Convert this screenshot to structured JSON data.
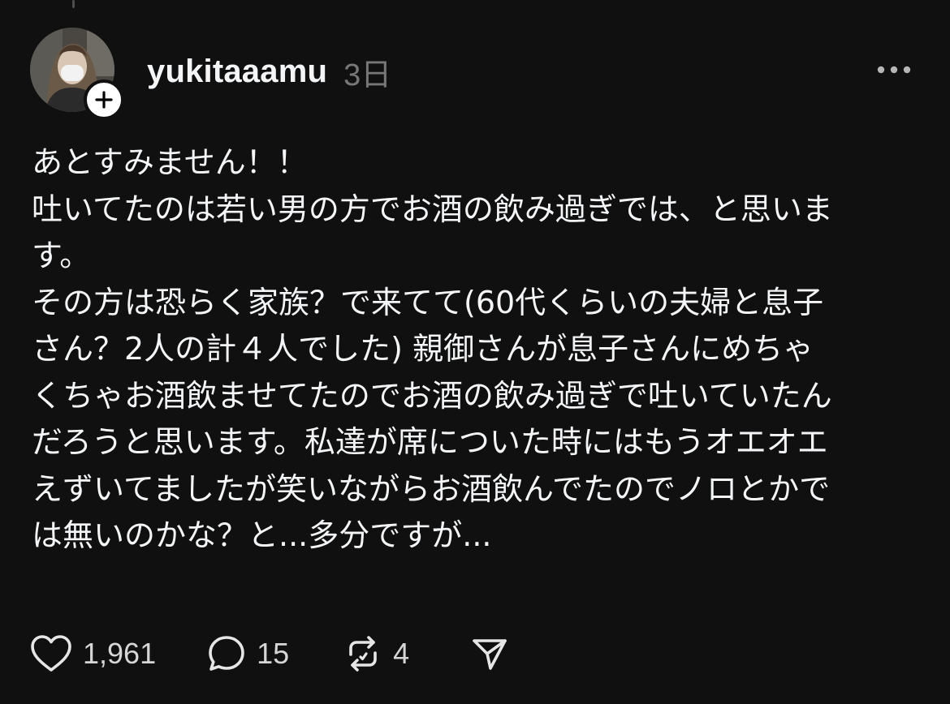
{
  "post": {
    "username": "yukitaaamu",
    "timestamp": "3日",
    "lines": [
      "あとすみません！！",
      "吐いてたのは若い男の方でお酒の飲み過ぎでは、と思いま",
      "す。",
      "その方は恐らく家族？で来てて(60代くらいの夫婦と息子",
      "さん？2人の計４人でした) 親御さんが息子さんにめちゃ",
      "くちゃお酒飲ませてたのでお酒の飲み過ぎで吐いていたん",
      "だろうと思います。私達が席についた時にはもうオエオエ",
      "えずいてましたが笑いながらお酒飲んでたのでノロとかで",
      "は無いのかな？と...多分ですが..."
    ]
  },
  "actions": {
    "likes": "1,961",
    "replies": "15",
    "reposts": "4"
  },
  "icons": {
    "more": "more-horizontal-icon",
    "like": "heart-icon",
    "reply": "comment-bubble-icon",
    "repost": "repost-icon",
    "share": "send-icon",
    "follow": "plus-icon"
  },
  "colors": {
    "background": "#101010",
    "text": "#f3f5f7",
    "secondary": "#777777"
  }
}
